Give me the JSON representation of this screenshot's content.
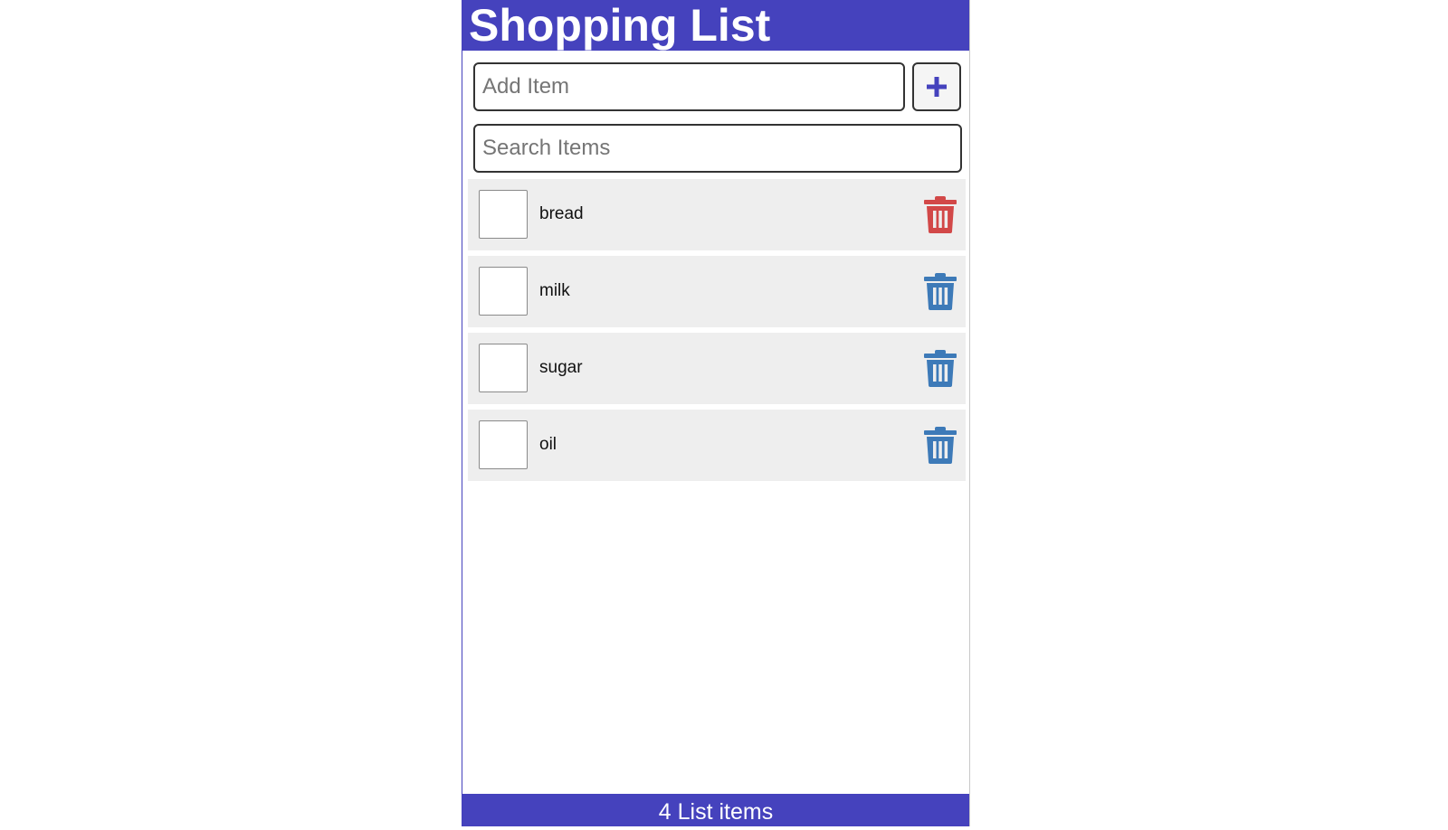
{
  "header": {
    "title": "Shopping List"
  },
  "add_item": {
    "placeholder": "Add Item",
    "value": "",
    "button_icon": "plus-icon"
  },
  "search": {
    "placeholder": "Search Items",
    "value": ""
  },
  "items": [
    {
      "label": "bread",
      "checked": false,
      "trash_color": "#d24848"
    },
    {
      "label": "milk",
      "checked": false,
      "trash_color": "#3d7ab8"
    },
    {
      "label": "sugar",
      "checked": false,
      "trash_color": "#3d7ab8"
    },
    {
      "label": "oil",
      "checked": false,
      "trash_color": "#3d7ab8"
    }
  ],
  "footer": {
    "count_text": "4 List items"
  },
  "colors": {
    "brand": "#4542bd",
    "trash_hover": "#d24848",
    "trash_default": "#3d7ab8"
  }
}
